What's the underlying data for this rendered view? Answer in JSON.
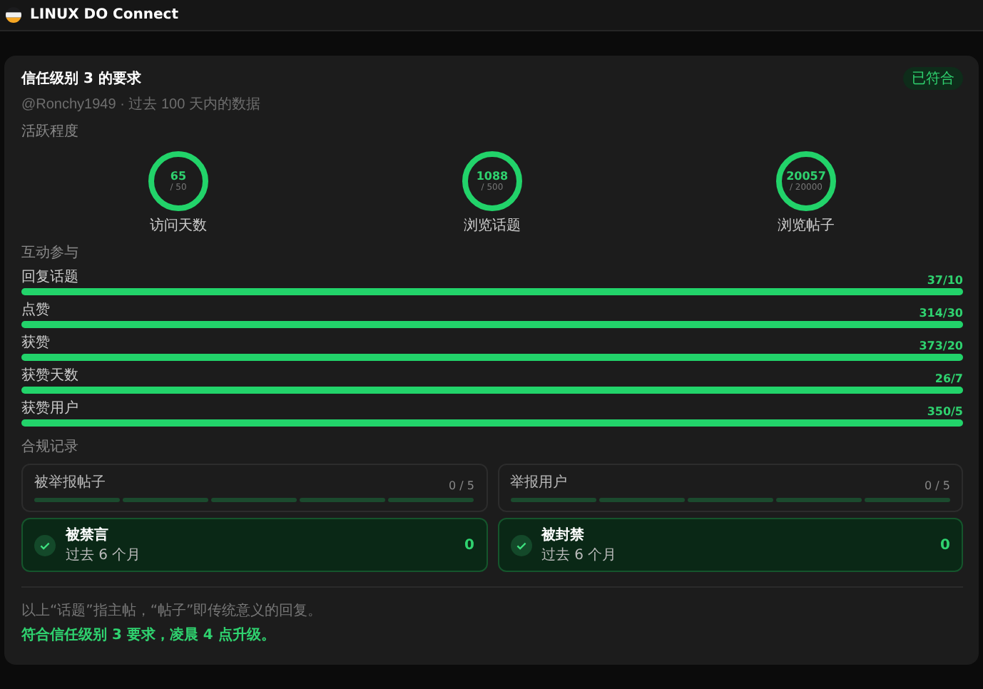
{
  "app": {
    "title": "LINUX DO Connect"
  },
  "card": {
    "title": "信任级别 3 的要求",
    "badge": "已符合",
    "subtitle": "@Ronchy1949 · 过去 100 天内的数据"
  },
  "activity": {
    "heading": "活跃程度",
    "rings": [
      {
        "value": "65",
        "target": "/ 50",
        "label": "访问天数"
      },
      {
        "value": "1088",
        "target": "/ 500",
        "label": "浏览话题"
      },
      {
        "value": "20057",
        "target": "/ 20000",
        "label": "浏览帖子"
      }
    ]
  },
  "interaction": {
    "heading": "互动参与",
    "bars": [
      {
        "label": "回复话题",
        "reading": "37/10",
        "level": 1
      },
      {
        "label": "点赞",
        "reading": "314/30",
        "level": 1
      },
      {
        "label": "获赞",
        "reading": "373/20",
        "level": 1
      },
      {
        "label": "获赞天数",
        "reading": "26/7",
        "level": 1
      },
      {
        "label": "获赞用户",
        "reading": "350/5",
        "level": 1
      }
    ]
  },
  "compliance": {
    "heading": "合规记录",
    "reports": [
      {
        "label": "被举报帖子",
        "reading": "0 / 5"
      },
      {
        "label": "举报用户",
        "reading": "0 / 5"
      }
    ],
    "records": [
      {
        "label": "被禁言",
        "period": "过去 6 个月",
        "count": "0",
        "passed": true
      },
      {
        "label": "被封禁",
        "period": "过去 6 个月",
        "count": "0",
        "passed": true
      }
    ]
  },
  "footer": {
    "note": "以上“话题”指主帖，“帖子”即传统意义的回复。",
    "result": "符合信任级别 3 要求，凌晨 4 点升级。"
  }
}
